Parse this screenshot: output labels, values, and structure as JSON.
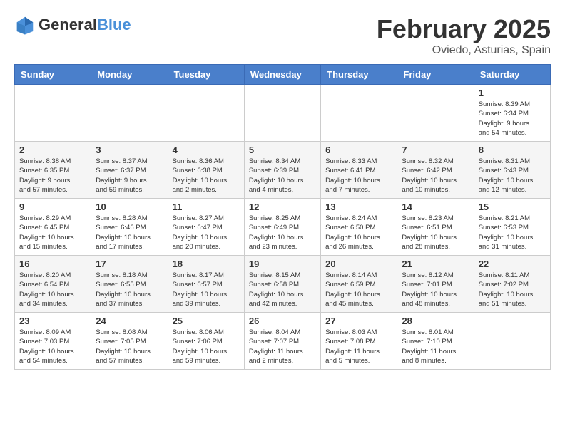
{
  "header": {
    "logo": {
      "general": "General",
      "blue": "Blue"
    },
    "title": "February 2025",
    "subtitle": "Oviedo, Asturias, Spain"
  },
  "weekdays": [
    "Sunday",
    "Monday",
    "Tuesday",
    "Wednesday",
    "Thursday",
    "Friday",
    "Saturday"
  ],
  "weeks": [
    [
      {
        "day": "",
        "info": ""
      },
      {
        "day": "",
        "info": ""
      },
      {
        "day": "",
        "info": ""
      },
      {
        "day": "",
        "info": ""
      },
      {
        "day": "",
        "info": ""
      },
      {
        "day": "",
        "info": ""
      },
      {
        "day": "1",
        "info": "Sunrise: 8:39 AM\nSunset: 6:34 PM\nDaylight: 9 hours\nand 54 minutes."
      }
    ],
    [
      {
        "day": "2",
        "info": "Sunrise: 8:38 AM\nSunset: 6:35 PM\nDaylight: 9 hours\nand 57 minutes."
      },
      {
        "day": "3",
        "info": "Sunrise: 8:37 AM\nSunset: 6:37 PM\nDaylight: 9 hours\nand 59 minutes."
      },
      {
        "day": "4",
        "info": "Sunrise: 8:36 AM\nSunset: 6:38 PM\nDaylight: 10 hours\nand 2 minutes."
      },
      {
        "day": "5",
        "info": "Sunrise: 8:34 AM\nSunset: 6:39 PM\nDaylight: 10 hours\nand 4 minutes."
      },
      {
        "day": "6",
        "info": "Sunrise: 8:33 AM\nSunset: 6:41 PM\nDaylight: 10 hours\nand 7 minutes."
      },
      {
        "day": "7",
        "info": "Sunrise: 8:32 AM\nSunset: 6:42 PM\nDaylight: 10 hours\nand 10 minutes."
      },
      {
        "day": "8",
        "info": "Sunrise: 8:31 AM\nSunset: 6:43 PM\nDaylight: 10 hours\nand 12 minutes."
      }
    ],
    [
      {
        "day": "9",
        "info": "Sunrise: 8:29 AM\nSunset: 6:45 PM\nDaylight: 10 hours\nand 15 minutes."
      },
      {
        "day": "10",
        "info": "Sunrise: 8:28 AM\nSunset: 6:46 PM\nDaylight: 10 hours\nand 17 minutes."
      },
      {
        "day": "11",
        "info": "Sunrise: 8:27 AM\nSunset: 6:47 PM\nDaylight: 10 hours\nand 20 minutes."
      },
      {
        "day": "12",
        "info": "Sunrise: 8:25 AM\nSunset: 6:49 PM\nDaylight: 10 hours\nand 23 minutes."
      },
      {
        "day": "13",
        "info": "Sunrise: 8:24 AM\nSunset: 6:50 PM\nDaylight: 10 hours\nand 26 minutes."
      },
      {
        "day": "14",
        "info": "Sunrise: 8:23 AM\nSunset: 6:51 PM\nDaylight: 10 hours\nand 28 minutes."
      },
      {
        "day": "15",
        "info": "Sunrise: 8:21 AM\nSunset: 6:53 PM\nDaylight: 10 hours\nand 31 minutes."
      }
    ],
    [
      {
        "day": "16",
        "info": "Sunrise: 8:20 AM\nSunset: 6:54 PM\nDaylight: 10 hours\nand 34 minutes."
      },
      {
        "day": "17",
        "info": "Sunrise: 8:18 AM\nSunset: 6:55 PM\nDaylight: 10 hours\nand 37 minutes."
      },
      {
        "day": "18",
        "info": "Sunrise: 8:17 AM\nSunset: 6:57 PM\nDaylight: 10 hours\nand 39 minutes."
      },
      {
        "day": "19",
        "info": "Sunrise: 8:15 AM\nSunset: 6:58 PM\nDaylight: 10 hours\nand 42 minutes."
      },
      {
        "day": "20",
        "info": "Sunrise: 8:14 AM\nSunset: 6:59 PM\nDaylight: 10 hours\nand 45 minutes."
      },
      {
        "day": "21",
        "info": "Sunrise: 8:12 AM\nSunset: 7:01 PM\nDaylight: 10 hours\nand 48 minutes."
      },
      {
        "day": "22",
        "info": "Sunrise: 8:11 AM\nSunset: 7:02 PM\nDaylight: 10 hours\nand 51 minutes."
      }
    ],
    [
      {
        "day": "23",
        "info": "Sunrise: 8:09 AM\nSunset: 7:03 PM\nDaylight: 10 hours\nand 54 minutes."
      },
      {
        "day": "24",
        "info": "Sunrise: 8:08 AM\nSunset: 7:05 PM\nDaylight: 10 hours\nand 57 minutes."
      },
      {
        "day": "25",
        "info": "Sunrise: 8:06 AM\nSunset: 7:06 PM\nDaylight: 10 hours\nand 59 minutes."
      },
      {
        "day": "26",
        "info": "Sunrise: 8:04 AM\nSunset: 7:07 PM\nDaylight: 11 hours\nand 2 minutes."
      },
      {
        "day": "27",
        "info": "Sunrise: 8:03 AM\nSunset: 7:08 PM\nDaylight: 11 hours\nand 5 minutes."
      },
      {
        "day": "28",
        "info": "Sunrise: 8:01 AM\nSunset: 7:10 PM\nDaylight: 11 hours\nand 8 minutes."
      },
      {
        "day": "",
        "info": ""
      }
    ]
  ]
}
